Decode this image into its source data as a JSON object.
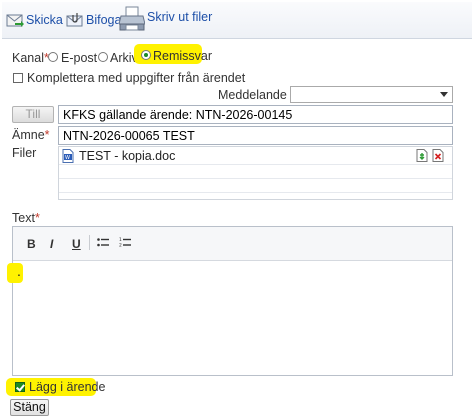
{
  "toolbar": {
    "send_label": "Skicka",
    "attach_label": "Bifoga",
    "print_label": "Skriv ut filer"
  },
  "channel": {
    "label": "Kanal",
    "required_mark": "*",
    "options": [
      "E-post",
      "Arkiv",
      "Remissvar"
    ],
    "selected": "Remissvar"
  },
  "complement": {
    "label": "Komplettera med uppgifter från ärendet",
    "checked": false
  },
  "message": {
    "label": "Meddelande",
    "value": ""
  },
  "to": {
    "button_label": "Till",
    "value": "KFKS gällande ärende: NTN-2026-00145"
  },
  "subject": {
    "label": "Ämne",
    "required_mark": "*",
    "value": "NTN-2026-00065 TEST"
  },
  "files": {
    "label": "Filer",
    "items": [
      {
        "name": "TEST - kopia.doc"
      }
    ]
  },
  "text": {
    "label": "Text",
    "required_mark": "*",
    "toolbar": [
      "B",
      "I",
      "U"
    ],
    "body": "."
  },
  "add_to_case": {
    "label": "Lägg i ärende",
    "checked": true
  },
  "close_button": "Stäng",
  "colors": {
    "highlight": "#fff200",
    "link_blue": "#1d4fa8",
    "required_red": "#c0392b",
    "check_green": "#1c8a25"
  }
}
